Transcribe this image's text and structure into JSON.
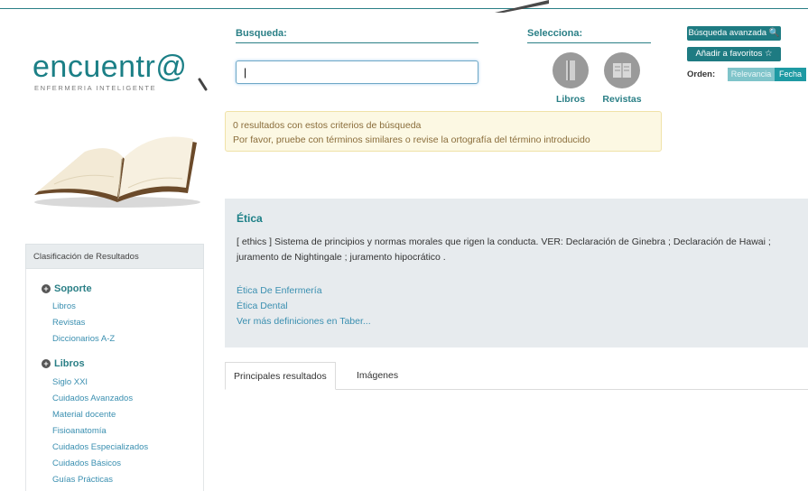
{
  "logo": {
    "word": "encuentr@",
    "tagline": "ENFERMERIA INTELIGENTE"
  },
  "search": {
    "label": "Busqueda:",
    "value": "|"
  },
  "select": {
    "label": "Selecciona:",
    "sources": [
      {
        "label": "Libros"
      },
      {
        "label": "Revistas"
      }
    ]
  },
  "actions": {
    "advanced_search": "Búsqueda avanzada",
    "advanced_icon": "zoom-in-icon",
    "favorites": "Añadir a favoritos",
    "favorites_icon": "star-icon"
  },
  "order": {
    "label": "Orden:",
    "options": [
      "Relevancia",
      "Fecha"
    ],
    "selected": "Fecha"
  },
  "alert": {
    "line1": "0 resultados con estos criterios de búsqueda",
    "line2": "Por favor, pruebe con términos similares o revise la ortografía del término introducido"
  },
  "sidebar": {
    "header": "Clasificación de Resultados",
    "groups": [
      {
        "title": "Soporte",
        "items": [
          "Libros",
          "Revistas",
          "Diccionarios A-Z"
        ]
      },
      {
        "title": "Libros",
        "items": [
          "Siglo XXI",
          "Cuidados Avanzados",
          "Material docente",
          "Fisioanatomía",
          "Cuidados Especializados",
          "Cuidados Básicos",
          "Guías Prácticas"
        ]
      }
    ]
  },
  "definition": {
    "title": "Ética",
    "text": "[ ethics ] Sistema de principios y normas morales que rigen la conducta. VER: Declaración de Ginebra ; Declaración de Hawai ; juramento de Nightingale ; juramento hipocrático .",
    "links": [
      "Ética De Enfermería",
      "Ética Dental",
      "Ver más definiciones en Taber..."
    ]
  },
  "tabs": [
    {
      "label": "Principales resultados"
    },
    {
      "label": "Imágenes"
    }
  ],
  "colors": {
    "primary": "#1e7b82",
    "link": "#3a8fb0",
    "alert_bg": "#fcf8e3",
    "panel_bg": "#e7ebee"
  }
}
